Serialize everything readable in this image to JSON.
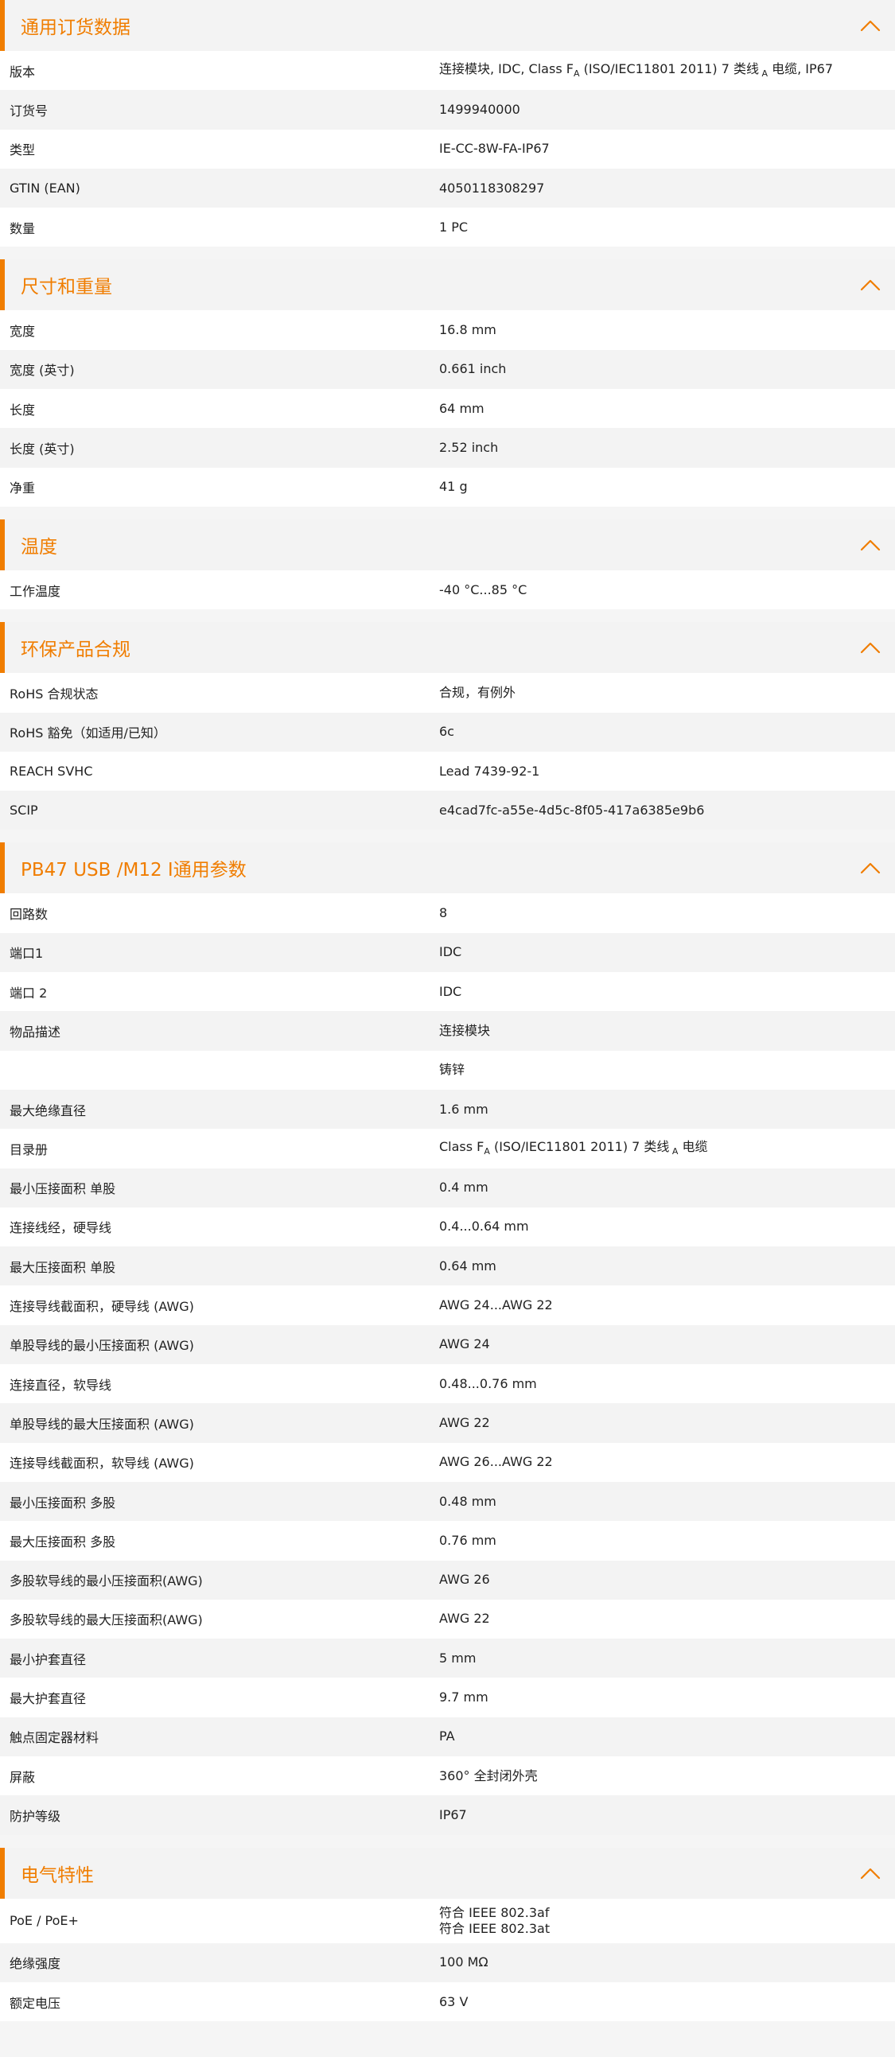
{
  "accent_color": "#f07d00",
  "sections": [
    {
      "title": "通用订货数据",
      "rows": [
        {
          "label": "版本",
          "value_html": "连接模块, IDC, Class F<sub>A</sub> (ISO/IEC11801 2011) 7 类线<sub> A</sub> 电缆, IP67"
        },
        {
          "label": "订货号",
          "value": "1499940000"
        },
        {
          "label": "类型",
          "value": "IE-CC-8W-FA-IP67"
        },
        {
          "label": "GTIN (EAN)",
          "value": "4050118308297"
        },
        {
          "label": "数量",
          "value": "1  PC"
        }
      ]
    },
    {
      "title": "尺寸和重量",
      "rows": [
        {
          "label": "宽度",
          "value": "16.8  mm"
        },
        {
          "label": "宽度 (英寸)",
          "value": "0.661  inch"
        },
        {
          "label": "长度",
          "value": "64  mm"
        },
        {
          "label": "长度 (英寸)",
          "value": "2.52  inch"
        },
        {
          "label": "净重",
          "value": "41  g"
        }
      ]
    },
    {
      "title": "温度",
      "rows": [
        {
          "label": "工作温度",
          "value": "-40 °C...85 °C"
        }
      ]
    },
    {
      "title": "环保产品合规",
      "rows": [
        {
          "label": "RoHS 合规状态",
          "value": "合规，有例外"
        },
        {
          "label": "RoHS 豁免（如适用/已知）",
          "value": "6c"
        },
        {
          "label": "REACH SVHC",
          "value": "Lead 7439-92-1"
        },
        {
          "label": "SCIP",
          "value": "e4cad7fc-a55e-4d5c-8f05-417a6385e9b6"
        }
      ]
    },
    {
      "title": "PB47 USB /M12 I通用参数",
      "rows": [
        {
          "label": "回路数",
          "value": "8"
        },
        {
          "label": "端口1",
          "value": "IDC"
        },
        {
          "label": "端口 2",
          "value": "IDC"
        },
        {
          "label": "物品描述",
          "value": "连接模块"
        },
        {
          "label": "",
          "value": "铸锌"
        },
        {
          "label": "最大绝缘直径",
          "value": "1.6  mm"
        },
        {
          "label": "目录册",
          "value_html": "Class F<sub>A</sub> (ISO/IEC11801 2011) 7 类线<sub> A</sub> 电缆"
        },
        {
          "label": "最小压接面积 单股",
          "value": "0.4  mm"
        },
        {
          "label": "连接线经，硬导线",
          "value": "0.4...0.64 mm"
        },
        {
          "label": "最大压接面积 单股",
          "value": "0.64  mm"
        },
        {
          "label": "连接导线截面积，硬导线 (AWG)",
          "value": "AWG 24...AWG 22"
        },
        {
          "label": "单股导线的最小压接面积 (AWG)",
          "value": "AWG 24"
        },
        {
          "label": "连接直径，软导线",
          "value": "0.48...0.76 mm"
        },
        {
          "label": "单股导线的最大压接面积 (AWG)",
          "value": "AWG 22"
        },
        {
          "label": "连接导线截面积，软导线 (AWG)",
          "value": "AWG 26...AWG 22"
        },
        {
          "label": "最小压接面积 多股",
          "value": "0.48  mm"
        },
        {
          "label": "最大压接面积 多股",
          "value": "0.76  mm"
        },
        {
          "label": "多股软导线的最小压接面积(AWG)",
          "value": "AWG 26"
        },
        {
          "label": "多股软导线的最大压接面积(AWG)",
          "value": "AWG 22"
        },
        {
          "label": "最小护套直径",
          "value": "5  mm"
        },
        {
          "label": "最大护套直径",
          "value": "9.7  mm"
        },
        {
          "label": "触点固定器材料",
          "value": "PA"
        },
        {
          "label": "屏蔽",
          "value": "360° 全封闭外壳"
        },
        {
          "label": "防护等级",
          "value": "IP67"
        }
      ]
    },
    {
      "title": "电气特性",
      "rows": [
        {
          "label": "PoE / PoE+",
          "value_lines": [
            "符合 IEEE 802.3af",
            "符合 IEEE 802.3at"
          ]
        },
        {
          "label": "绝缘强度",
          "value": "100 MΩ"
        },
        {
          "label": "额定电压",
          "value": "63  V"
        }
      ]
    }
  ]
}
